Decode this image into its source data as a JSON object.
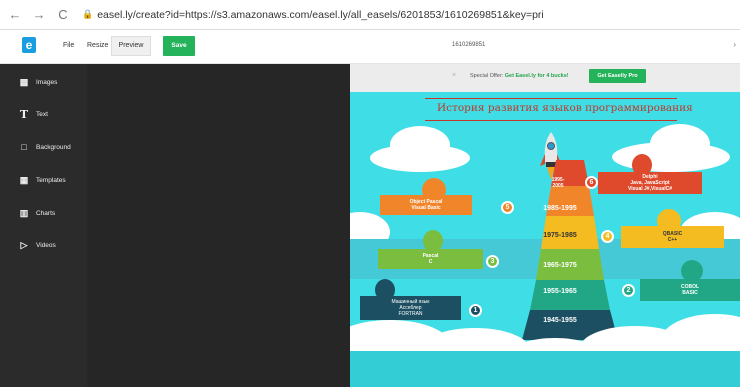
{
  "browser": {
    "back": "←",
    "forward": "→",
    "reload": "C",
    "url": "easel.ly/create?id=https://s3.amazonaws.com/easel.ly/all_easels/6201853/1610269851&key=pri"
  },
  "header": {
    "logo": "e",
    "file": "File",
    "resize": "Resize",
    "preview": "Preview",
    "save": "Save",
    "doc_title": "1610269851"
  },
  "sidebar": {
    "items": [
      {
        "label": "Images",
        "icon": "image-icon"
      },
      {
        "label": "Text",
        "icon": "text-icon"
      },
      {
        "label": "Background",
        "icon": "background-icon"
      },
      {
        "label": "Templates",
        "icon": "templates-icon"
      },
      {
        "label": "Charts",
        "icon": "charts-icon"
      },
      {
        "label": "Videos",
        "icon": "video-icon"
      }
    ]
  },
  "offer": {
    "prefix": "Special Offer: ",
    "link": "Get Easel.ly for 4 bucks!",
    "button": "Get Easelly Pro"
  },
  "infographic": {
    "title": "История развития языков программирования",
    "pyramid": [
      {
        "text": "1995-\n2005"
      },
      {
        "text": "1985-1995"
      },
      {
        "text": "1975-1985"
      },
      {
        "text": "1965-1975"
      },
      {
        "text": "1955-1965"
      },
      {
        "text": "1945-1955"
      }
    ],
    "numbers": [
      "6",
      "5",
      "4",
      "3",
      "2",
      "1"
    ],
    "boxes": {
      "delphi": "Delphi\nJava, JavaScript\nVisual J#,VisualC#",
      "object_pascal": "Object Pascal\nVisual Basic",
      "qbasic": "QBASIC\nC++",
      "pascal": "Pascal\nC",
      "cobol": "COBOL\nBASIC",
      "machine": "Машинный язык\nАссеблер\nFORTRAN"
    }
  },
  "colors": {
    "accent_green": "#24b35a",
    "sidebar_bg": "#2b2b2b",
    "canvas_sky": "#3fdde6",
    "title_red": "#c0392b"
  }
}
